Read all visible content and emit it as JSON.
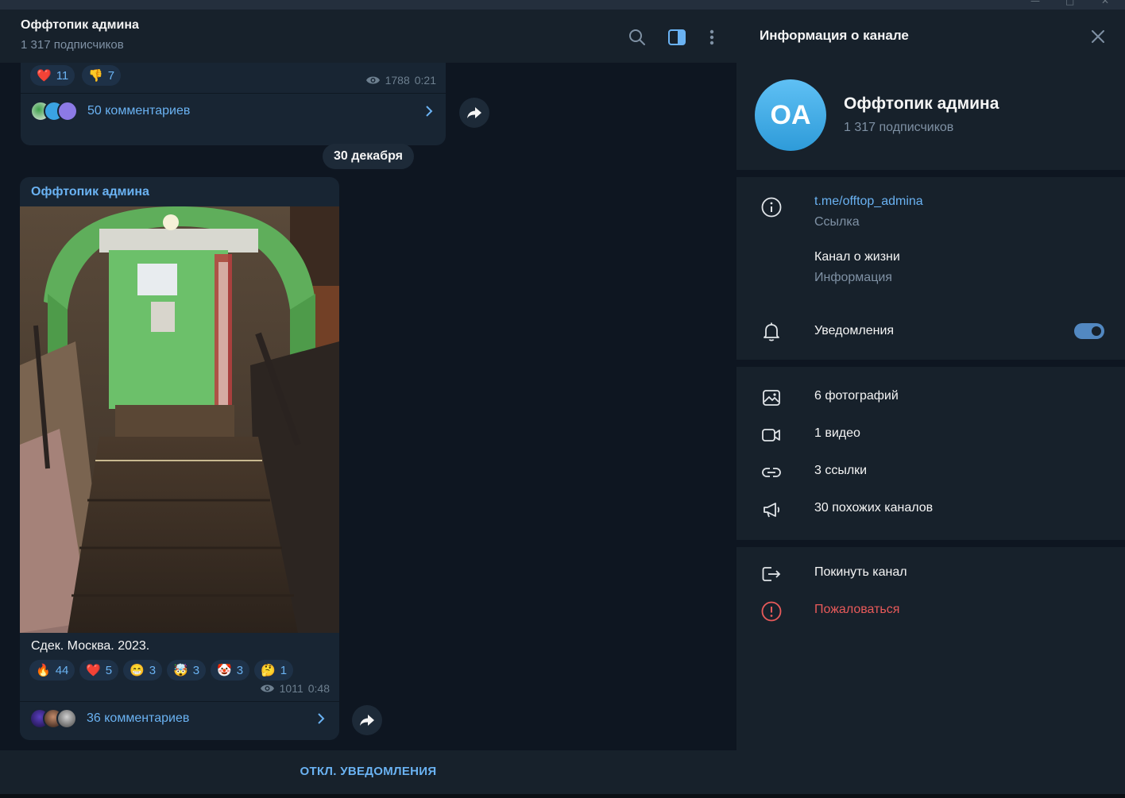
{
  "chat": {
    "title": "Оффтопик админа",
    "subtitle": "1 317 подписчиков"
  },
  "header_icons": [
    "search-icon",
    "sidebar-toggle-icon",
    "more-vertical-icon"
  ],
  "message_top": {
    "reactions": [
      {
        "emoji": "❤️",
        "count": "11"
      },
      {
        "emoji": "👎",
        "count": "7"
      }
    ],
    "views": "1788",
    "time": "0:21",
    "comments": "50 комментариев"
  },
  "date_separator": "30 декабря",
  "message_main": {
    "author": "Оффтопик админа",
    "caption": "Сдек. Москва. 2023.",
    "reactions": [
      {
        "emoji": "🔥",
        "count": "44"
      },
      {
        "emoji": "❤️",
        "count": "5"
      },
      {
        "emoji": "😁",
        "count": "3"
      },
      {
        "emoji": "🤯",
        "count": "3"
      },
      {
        "emoji": "🤡",
        "count": "3"
      },
      {
        "emoji": "🤔",
        "count": "1"
      }
    ],
    "views": "1011",
    "time": "0:48",
    "comments": "36 комментариев"
  },
  "bottom_action": "ОТКЛ. УВЕДОМЛЕНИЯ",
  "info": {
    "panel_title": "Информация о канале",
    "avatar_initials": "OA",
    "name": "Оффтопик админа",
    "subscribers": "1 317 подписчиков",
    "link": "t.me/offtop_admina",
    "link_label": "Ссылка",
    "about": "Канал о жизни",
    "about_label": "Информация",
    "notifications": "Уведомления",
    "notifications_on": true,
    "media": {
      "photos": "6 фотографий",
      "videos": "1 видео",
      "links": "3 ссылки",
      "similar": "30 похожих каналов"
    },
    "leave": "Покинуть канал",
    "report": "Пожаловаться"
  },
  "colors": {
    "accent": "#6ab2f2",
    "panel_bg": "#17212b",
    "chat_bg": "#0e1621",
    "bubble_bg": "#182533",
    "danger": "#e85a5a",
    "toggle": "#5288c1"
  }
}
